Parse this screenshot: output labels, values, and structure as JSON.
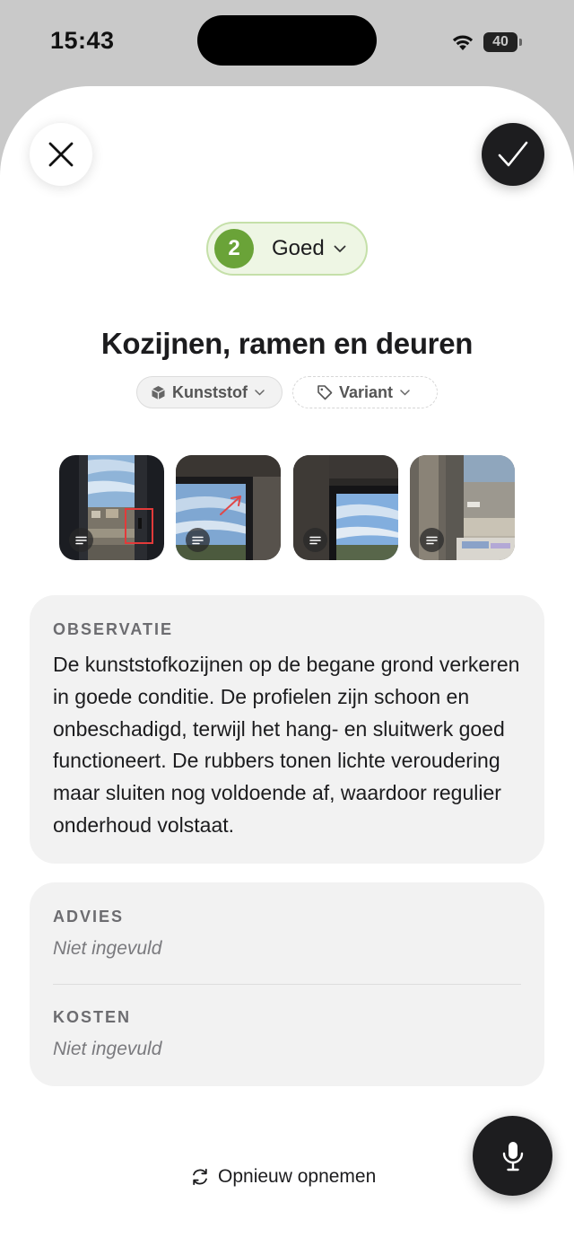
{
  "status_bar": {
    "time": "15:43",
    "battery": "40"
  },
  "rating": {
    "number": "2",
    "label": "Goed",
    "color": "#6aa338"
  },
  "title": "Kozijnen, ramen en deuren",
  "chips": {
    "material": "Kunststof",
    "variant": "Variant"
  },
  "photos": [
    {
      "name": "photo-1",
      "icon": "note-icon"
    },
    {
      "name": "photo-2",
      "icon": "note-icon"
    },
    {
      "name": "photo-3",
      "icon": "note-icon"
    },
    {
      "name": "photo-4",
      "icon": "note-icon"
    }
  ],
  "observation": {
    "label": "OBSERVATIE",
    "text": "De kunststofkozijnen op de begane grond verkeren in goede conditie. De profielen zijn schoon en onbeschadigd, terwijl het hang- en sluitwerk goed functioneert. De rubbers tonen lichte veroudering maar sluiten nog voldoende af, waardoor regulier onderhoud volstaat."
  },
  "advice": {
    "label": "ADVIES",
    "value": "Niet ingevuld"
  },
  "costs": {
    "label": "KOSTEN",
    "value": "Niet ingevuld"
  },
  "actions": {
    "rerecord": "Opnieuw opnemen"
  }
}
